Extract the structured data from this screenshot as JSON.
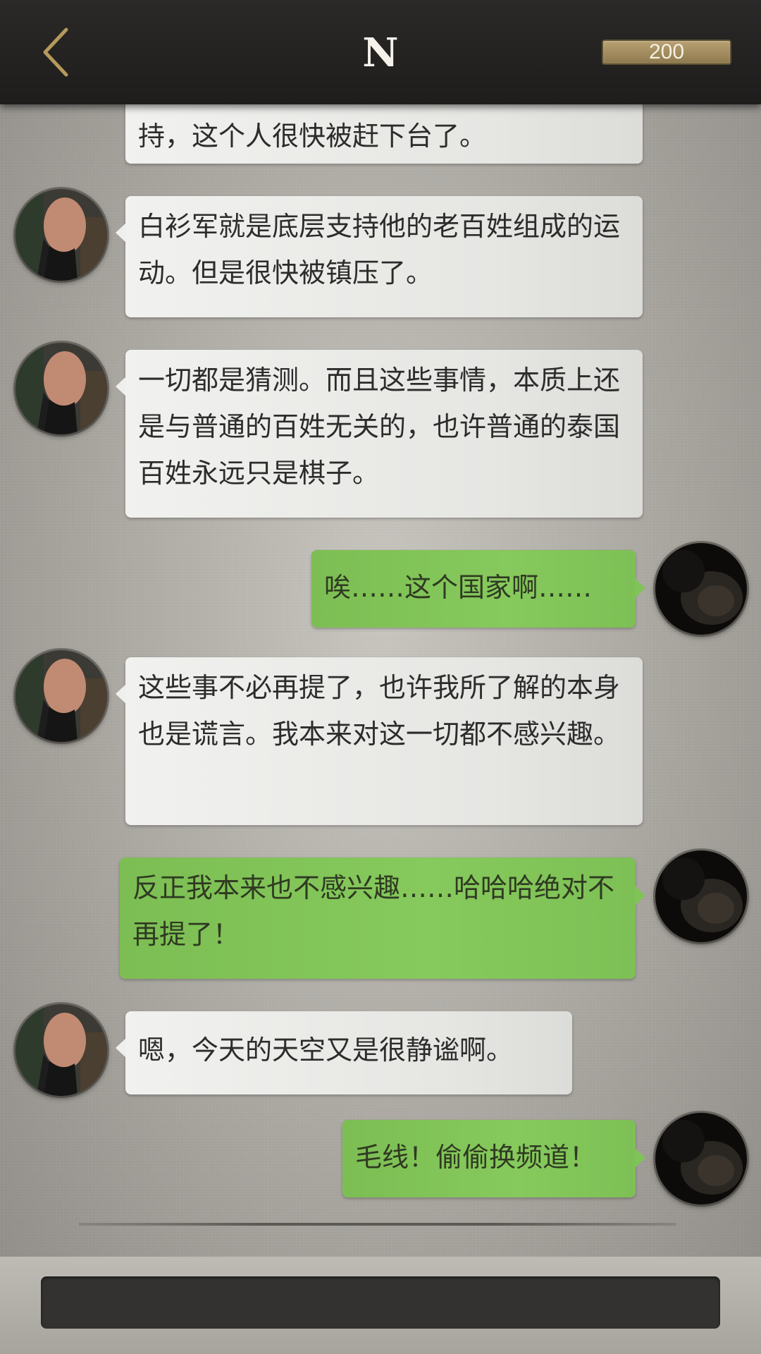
{
  "header": {
    "title": "N",
    "coins": "200"
  },
  "messages": [
    {
      "side": "left",
      "text": "持，这个人很快被赶下台了。"
    },
    {
      "side": "left",
      "text": "白衫军就是底层支持他的老百姓组成的运动。但是很快被镇压了。"
    },
    {
      "side": "left",
      "text": "一切都是猜测。而且这些事情，本质上还是与普通的百姓无关的，也许普通的泰国百姓永远只是棋子。"
    },
    {
      "side": "right",
      "text": "唉……这个国家啊……"
    },
    {
      "side": "left",
      "text": "这些事不必再提了，也许我所了解的本身也是谎言。我本来对这一切都不感兴趣。"
    },
    {
      "side": "right",
      "text": "反正我本来也不感兴趣……哈哈哈绝对不再提了！"
    },
    {
      "side": "left",
      "text": "嗯，今天的天空又是很静谧啊。"
    },
    {
      "side": "right",
      "text": "毛线！偷偷换频道！"
    }
  ],
  "colors": {
    "incoming_bubble": "#efefed",
    "outgoing_bubble": "#80c357",
    "header_bg": "#232221",
    "coin_badge": "#a38d5f"
  },
  "icons": {
    "back": "chevron-left-icon",
    "contact_avatar": "man-portrait-avatar",
    "user_avatar": "dark-cat-avatar"
  }
}
